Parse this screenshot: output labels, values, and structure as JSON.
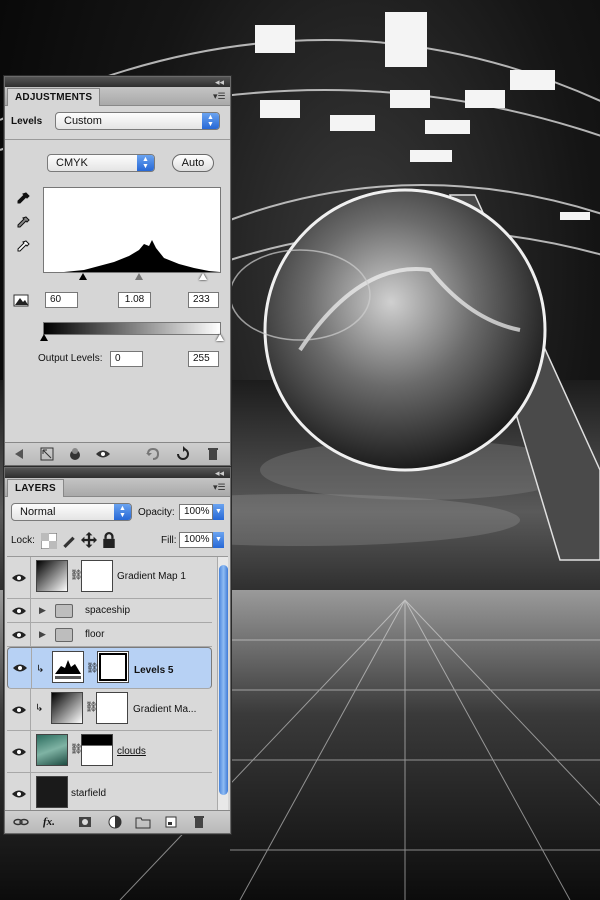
{
  "adjustments": {
    "tab": "ADJUSTMENTS",
    "preset_label": "Levels",
    "preset_value": "Custom",
    "channel": "CMYK",
    "auto_label": "Auto",
    "input_black": "60",
    "input_mid": "1.08",
    "input_white": "233",
    "output_label": "Output Levels:",
    "output_black": "0",
    "output_white": "255",
    "icons": [
      "black-eyedropper-icon",
      "gray-eyedropper-icon",
      "white-eyedropper-icon",
      "clipping-warning-icon"
    ],
    "footer_icons": [
      "back-arrow-icon",
      "expand-view-icon",
      "clip-to-layer-icon",
      "visibility-eye-icon",
      "view-previous-state-icon",
      "reset-icon",
      "delete-icon"
    ]
  },
  "layers": {
    "tab": "LAYERS",
    "blend_mode": "Normal",
    "opacity_label": "Opacity:",
    "opacity_value": "100%",
    "lock_label": "Lock:",
    "fill_label": "Fill:",
    "fill_value": "100%",
    "items": [
      {
        "name": "Gradient Map 1",
        "kind": "adjustment",
        "selected": false
      },
      {
        "name": "spaceship",
        "kind": "group",
        "selected": false
      },
      {
        "name": "floor",
        "kind": "group",
        "selected": false
      },
      {
        "name": "Levels 5",
        "kind": "adjustment",
        "selected": true
      },
      {
        "name": "Gradient Ma...",
        "kind": "adjustment",
        "selected": false
      },
      {
        "name": "clouds",
        "kind": "pixel",
        "selected": false
      },
      {
        "name": "starfield",
        "kind": "pixel",
        "selected": false
      }
    ],
    "footer_icons": [
      "link-layers-icon",
      "layer-style-fx-icon",
      "add-mask-icon",
      "new-adjustment-icon",
      "new-group-icon",
      "new-layer-icon",
      "trash-icon"
    ]
  },
  "colors": {
    "accent": "#2768d6",
    "selected_row": "#b7d1f4",
    "panel": "#d6d6d6"
  }
}
